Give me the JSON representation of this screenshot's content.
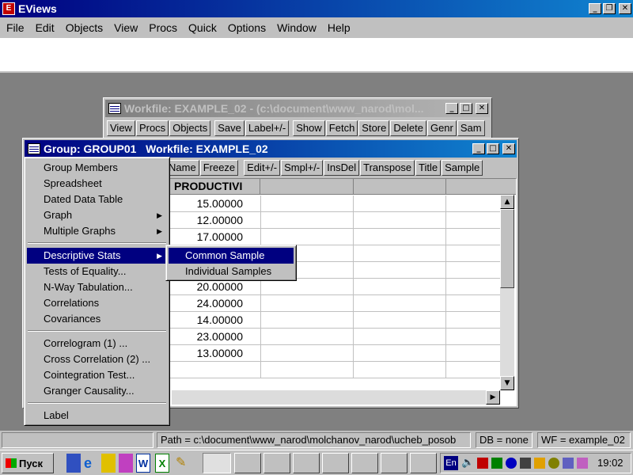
{
  "app": {
    "title": "EViews"
  },
  "menubar": [
    "File",
    "Edit",
    "Objects",
    "View",
    "Procs",
    "Quick",
    "Options",
    "Window",
    "Help"
  ],
  "workfile_window": {
    "title": "Workfile: EXAMPLE_02 - (c:\\document\\www_narod\\mol...",
    "toolbar": [
      "View",
      "Procs",
      "Objects",
      "Save",
      "Label+/-",
      "Show",
      "Fetch",
      "Store",
      "Delete",
      "Genr",
      "Sam"
    ]
  },
  "group_window": {
    "title": "Group: GROUP01   Workfile: EXAMPLE_02",
    "toolbar": [
      "Name",
      "Freeze",
      "Edit+/-",
      "Smpl+/-",
      "InsDel",
      "Transpose",
      "Title",
      "Sample"
    ],
    "column_header": "PRODUCTIVI",
    "values": [
      "15.00000",
      "12.00000",
      "17.00000",
      "",
      "",
      "20.00000",
      "24.00000",
      "14.00000",
      "23.00000",
      "13.00000"
    ]
  },
  "context_menu": {
    "items": [
      {
        "label": "Group Members"
      },
      {
        "label": "Spreadsheet"
      },
      {
        "label": "Dated Data Table"
      },
      {
        "label": "Graph",
        "submenu": true
      },
      {
        "label": "Multiple Graphs",
        "submenu": true
      },
      {
        "label": "Descriptive Stats",
        "submenu": true,
        "highlighted": true
      },
      {
        "label": "Tests of Equality..."
      },
      {
        "label": "N-Way Tabulation..."
      },
      {
        "label": "Correlations"
      },
      {
        "label": "Covariances"
      },
      {
        "label": "Correlogram (1) ..."
      },
      {
        "label": "Cross Correlation (2) ..."
      },
      {
        "label": "Cointegration Test..."
      },
      {
        "label": "Granger Causality..."
      },
      {
        "label": "Label"
      }
    ]
  },
  "submenu": {
    "items": [
      {
        "label": "Common Sample",
        "highlighted": true
      },
      {
        "label": "Individual Samples"
      }
    ]
  },
  "statusbar": {
    "path": "Path = c:\\document\\www_narod\\molchanov_narod\\ucheb_posob",
    "db": "DB = none",
    "wf": "WF = example_02"
  },
  "taskbar": {
    "start": "Пуск",
    "lang": "En",
    "clock": "19:02"
  },
  "colors": {
    "title_active": "#000080",
    "desktop": "#808080",
    "highlight": "#000080"
  }
}
